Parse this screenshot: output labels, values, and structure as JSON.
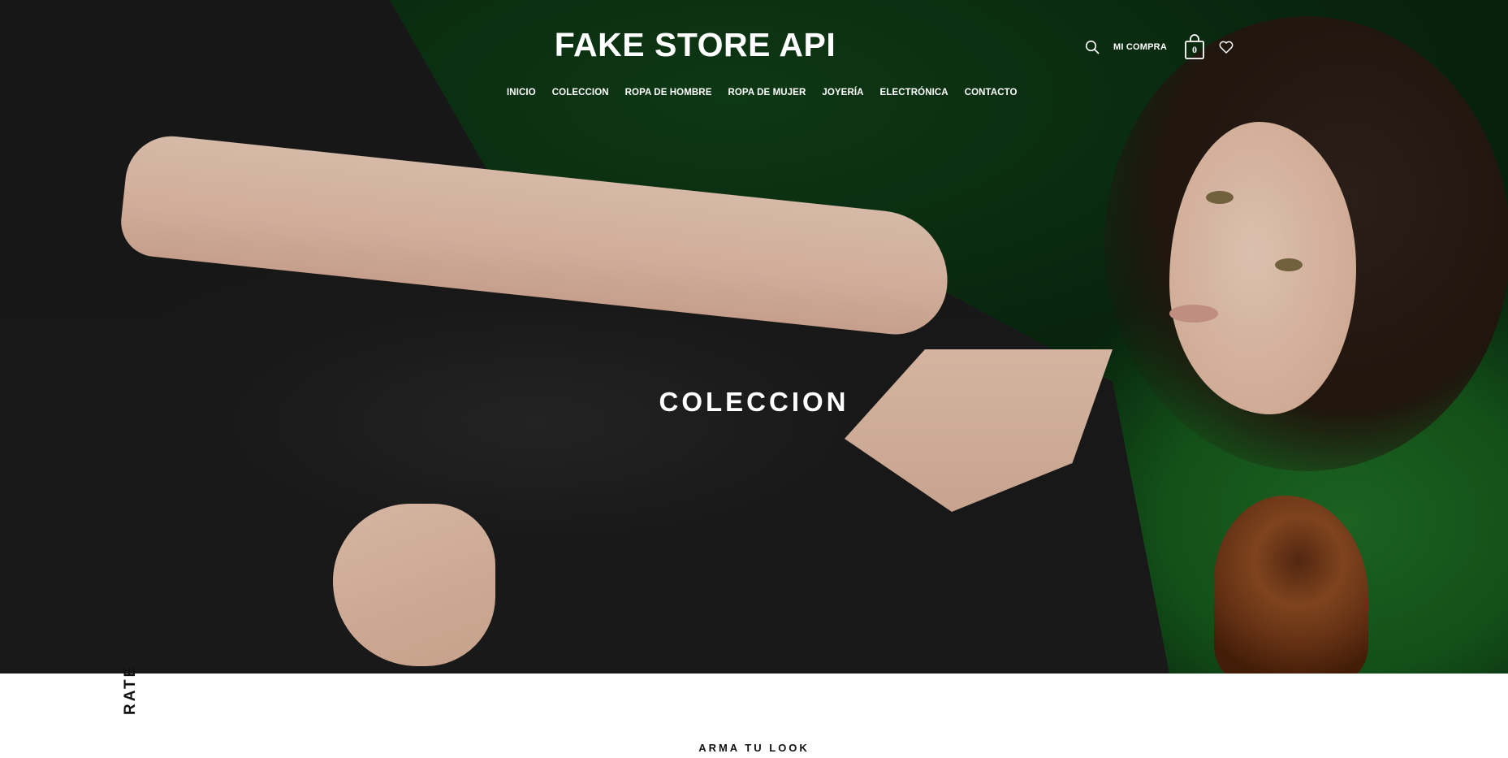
{
  "brand": {
    "logo_text": "FAKE STORE API"
  },
  "header": {
    "mi_compra_label": "MI COMPRA",
    "cart_count": "0",
    "icons": {
      "search": "search-icon",
      "cart": "shopping-bag-icon",
      "wishlist": "heart-icon"
    }
  },
  "nav": {
    "items": [
      {
        "label": "INICIO"
      },
      {
        "label": "COLECCION"
      },
      {
        "label": "ROPA DE HOMBRE"
      },
      {
        "label": "ROPA DE MUJER"
      },
      {
        "label": "JOYERÍA"
      },
      {
        "label": "ELECTRÓNICA"
      },
      {
        "label": "CONTACTO"
      }
    ]
  },
  "hero": {
    "title": "COLECCION"
  },
  "below": {
    "vertical_text": "RATE",
    "section_label": "ARMA TU LOOK"
  },
  "colors": {
    "hero_green": "#0d3614",
    "text_light": "#ffffff",
    "text_dark": "#111111"
  }
}
